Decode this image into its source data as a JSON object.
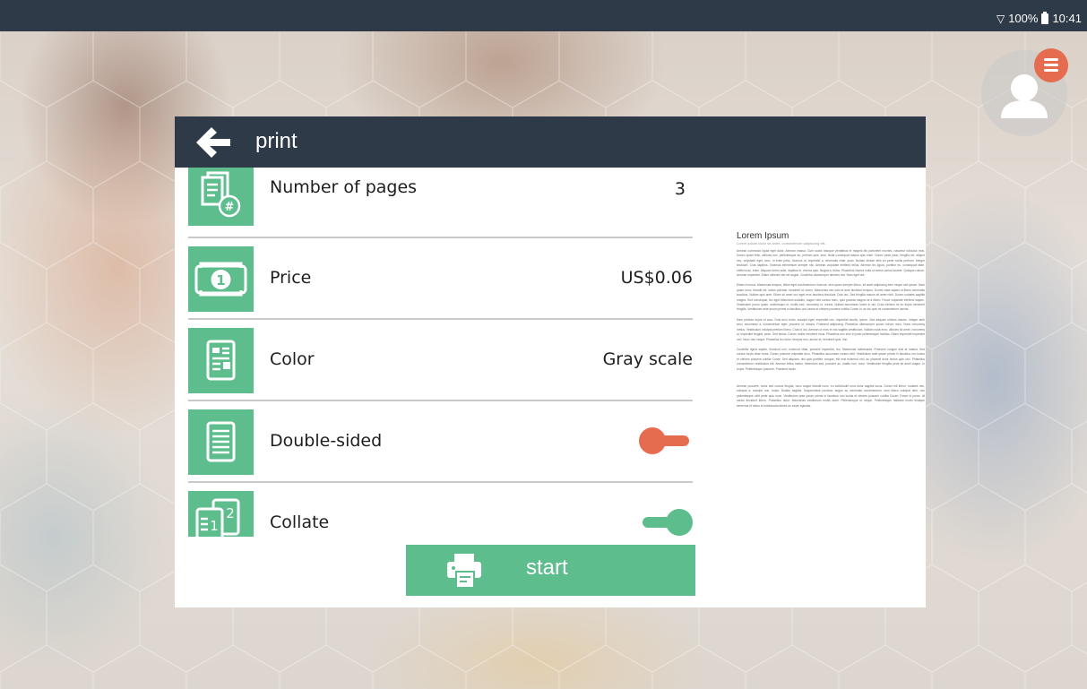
{
  "status_bar": {
    "battery_text": "100%",
    "time": "10:41"
  },
  "header": {
    "title": "print",
    "back_icon": "arrow-left-icon"
  },
  "settings": [
    {
      "label": "Number of pages",
      "value": "3",
      "icon": "pages-count-icon"
    },
    {
      "label": "Price",
      "value": "US$0.06",
      "icon": "banknote-icon"
    },
    {
      "label": "Color",
      "value": "Gray scale",
      "icon": "document-layout-icon"
    },
    {
      "label": "Double-sided",
      "toggle": "off",
      "icon": "document-lines-icon"
    },
    {
      "label": "Collate",
      "toggle": "on",
      "icon": "collate-icon"
    }
  ],
  "start_button": {
    "label": "start",
    "icon": "printer-icon"
  },
  "preview": {
    "title": "Lorem Ipsum",
    "subtitle": "Lorem ipsum dolor sit amet, consectetuer adipiscing elit.",
    "paragraphs": [
      "Aenean commodo ligula eget dolor. Aenean massa. Cum sociis natoque penatibus et magnis dis parturient montes, nascetur ridiculus mus. Donec quam felis, ultricies nec, pellentesque eu, pretium quis, sem. Nulla consequat massa quis enim. Donec pede justo, fringilla vel, aliquet nec, vulputate eget, arcu. In enim justo, rhoncus ut, imperdiet a, venenatis vitae, justo. Nullam dictum felis eu pede mollis pretium. Integer tincidunt. Cras dapibus. Vivamus elementum semper nisi. Aenean vulputate eleifend tellus. Aenean leo ligula, porttitor eu, consequat vitae, eleifend ac, enim. Aliquam lorem ante, dapibus in, viverra quis, feugiat a, tellus. Phasellus viverra nulla ut metus varius laoreet. Quisque rutrum. Aenean imperdiet. Etiam ultricies nisi vel augue. Curabitur ullamcorper ultricies nisi. Nam eget dui.",
      "Etiam rhoncus. Maecenas tempus, tellus eget condimentum rhoncus, sem quam semper libero, sit amet adipiscing sem neque sed ipsum. Nam quam nunc, blandit vel, luctus pulvinar, hendrerit id, lorem. Maecenas nec odio et ante tincidunt tempus. Donec vitae sapien ut libero venenatis faucibus. Nullam quis ante. Etiam sit amet orci eget eros faucibus tincidunt. Duis leo. Sed fringilla mauris sit amet nibh. Donec sodales sagittis magna. Sed consequat, leo eget bibendum sodales, augue velit cursus nunc, quis gravida magna mi a libero. Fusce vulputate eleifend sapien. Vestibulum purus quam, scelerisque ut, mollis sed, nonummy id, metus. Nullam accumsan lorem in dui. Cras ultricies mi eu turpis hendrerit fringilla. Vestibulum ante ipsum primis in faucibus orci luctus et ultrices posuere cubilia Curae; In ac dui quis mi consectetuer lacinia.",
      "Nam pretium turpis et arcu. Duis arcu tortor, suscipit eget, imperdiet nec, imperdiet iaculis, ipsum. Sed aliquam ultrices mauris. Integer ante arcu, accumsan a, consectetuer eget, posuere ut, mauris. Praesent adipiscing. Phasellus ullamcorper ipsum rutrum nunc. Nunc nonummy metus. Vestibulum volutpat pretium libero. Cras id dui. Aenean ut eros et nisl sagittis vestibulum. Nullam nulla eros, ultricies sit amet, nonummy id, imperdiet feugiat, pede. Sed lectus. Donec mollis hendrerit risus. Phasellus nec sem in justo pellentesque facilisis. Etiam imperdiet imperdiet orci. Nunc nec neque. Phasellus leo dolor, tempus non, auctor et, hendrerit quis, nisi.",
      "Curabitur ligula sapien, tincidunt non, euismod vitae, posuere imperdiet, leo. Maecenas malesuada. Praesent congue erat at massa. Sed cursus turpis vitae tortor. Donec posuere vulputate arcu. Phasellus accumsan cursus velit. Vestibulum ante ipsum primis in faucibus orci luctus et ultrices posuere cubilia Curae; Sed aliquam, nisi quis porttitor congue, elit erat euismod orci, ac placerat dolor lectus quis orci. Phasellus consectetuer vestibulum elit. Aenean tellus metus, bibendum sed, posuere ac, mattis non, nunc. Vestibulum fringilla pede sit amet augue. In turpis. Pellentesque posuere. Praesent turpis.",
      "Aenean posuere, tortor sed cursus feugiat, nunc augue blandit nunc, eu sollicitudin urna dolor sagittis lacus. Donec elit libero, sodales nec, volutpat a, suscipit non, turpis. Nullam sagittis. Suspendisse pulvinar, augue ac venenatis condimentum, sem libero volutpat nibh, nec pellentesque velit pede quis nunc. Vestibulum ante ipsum primis in faucibus orci luctus et ultrices posuere cubilia Curae; Fusce id purus. Ut varius tincidunt libero. Phasellus dolor. Maecenas vestibulum mollis diam. Pellentesque ut neque. Pellentesque habitant morbi tristique senectus et netus et malesuada fames ac turpis egestas."
    ]
  },
  "colors": {
    "header_bg": "#2e3a47",
    "accent_green": "#5dbd8c",
    "accent_orange": "#e56c4f"
  }
}
